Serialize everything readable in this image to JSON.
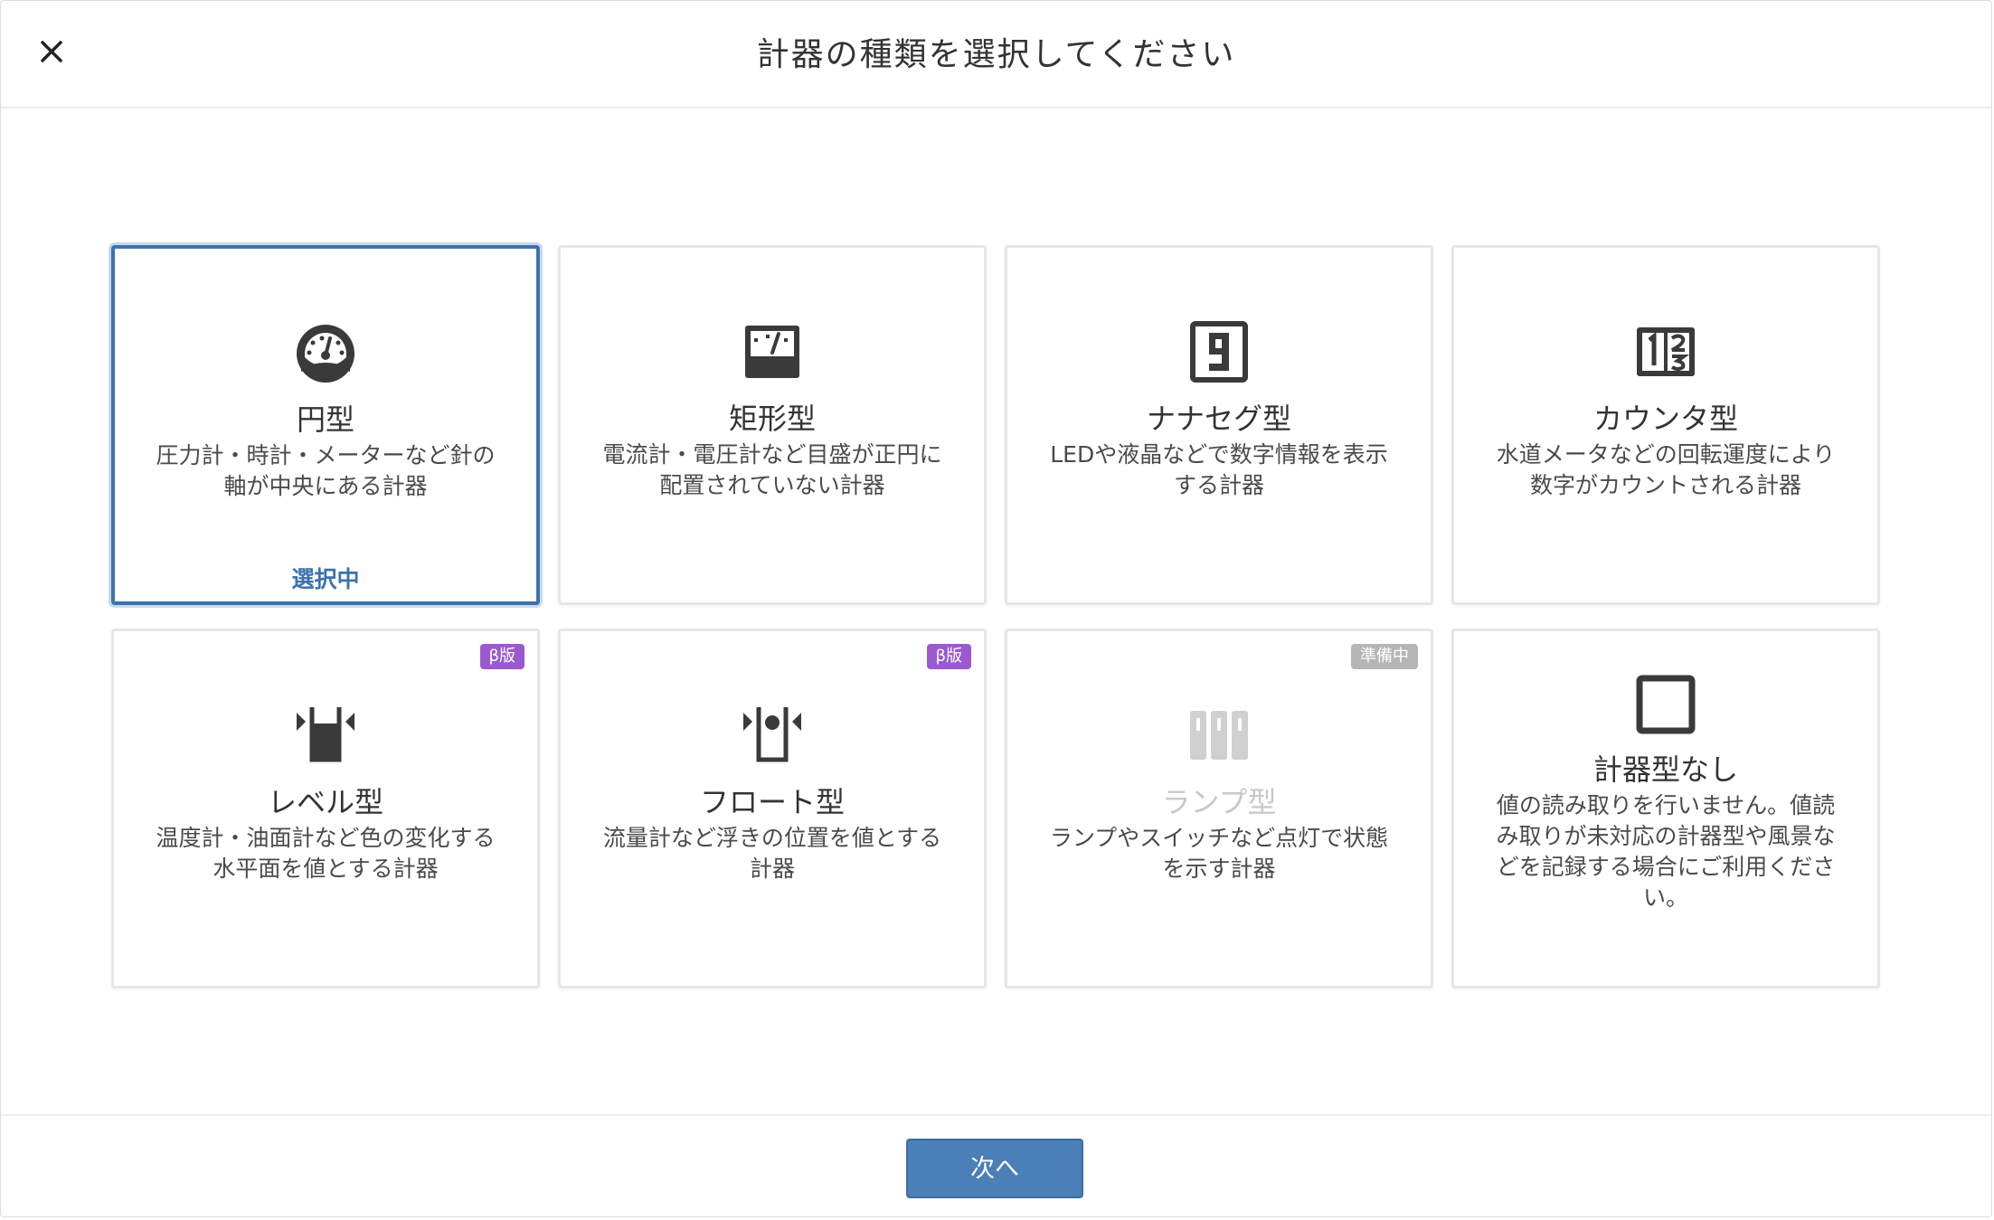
{
  "dialog": {
    "title": "計器の種類を選択してください",
    "close_icon": "close-icon"
  },
  "cards": [
    {
      "name": "円型",
      "description": "圧力計・時計・メーターなど針の軸が中央にある計器",
      "icon": "gauge-round-icon",
      "status": "選択中",
      "selected": true
    },
    {
      "name": "矩形型",
      "description": "電流計・電圧計など目盛が正円に配置されていない計器",
      "icon": "gauge-rect-icon"
    },
    {
      "name": "ナナセグ型",
      "description": "LEDや液晶などで数字情報を表示する計器",
      "icon": "seven-segment-icon"
    },
    {
      "name": "カウンタ型",
      "description": "水道メータなどの回転運度により数字がカウントされる計器",
      "icon": "counter-icon"
    },
    {
      "name": "レベル型",
      "description": "温度計・油面計など色の変化する水平面を値とする計器",
      "icon": "level-icon",
      "badge": "β版"
    },
    {
      "name": "フロート型",
      "description": "流量計など浮きの位置を値とする計器",
      "icon": "float-icon",
      "badge": "β版"
    },
    {
      "name": "ランプ型",
      "description": "ランプやスイッチなど点灯で状態を示す計器",
      "icon": "lamp-icon",
      "badge": "準備中",
      "disabled": true
    },
    {
      "name": "計器型なし",
      "description": "値の読み取りを行いません。値読み取りが未対応の計器型や風景などを記録する場合にご利用ください。",
      "icon": "empty-square-icon"
    }
  ],
  "footer": {
    "next_label": "次へ"
  },
  "colors": {
    "accent": "#3c73ad",
    "button": "#4a7fb8",
    "beta_badge": "#9b59d0",
    "pending_badge": "#b5b5b5",
    "icon": "#3a3a3a",
    "icon_disabled": "#d0d0d0"
  }
}
